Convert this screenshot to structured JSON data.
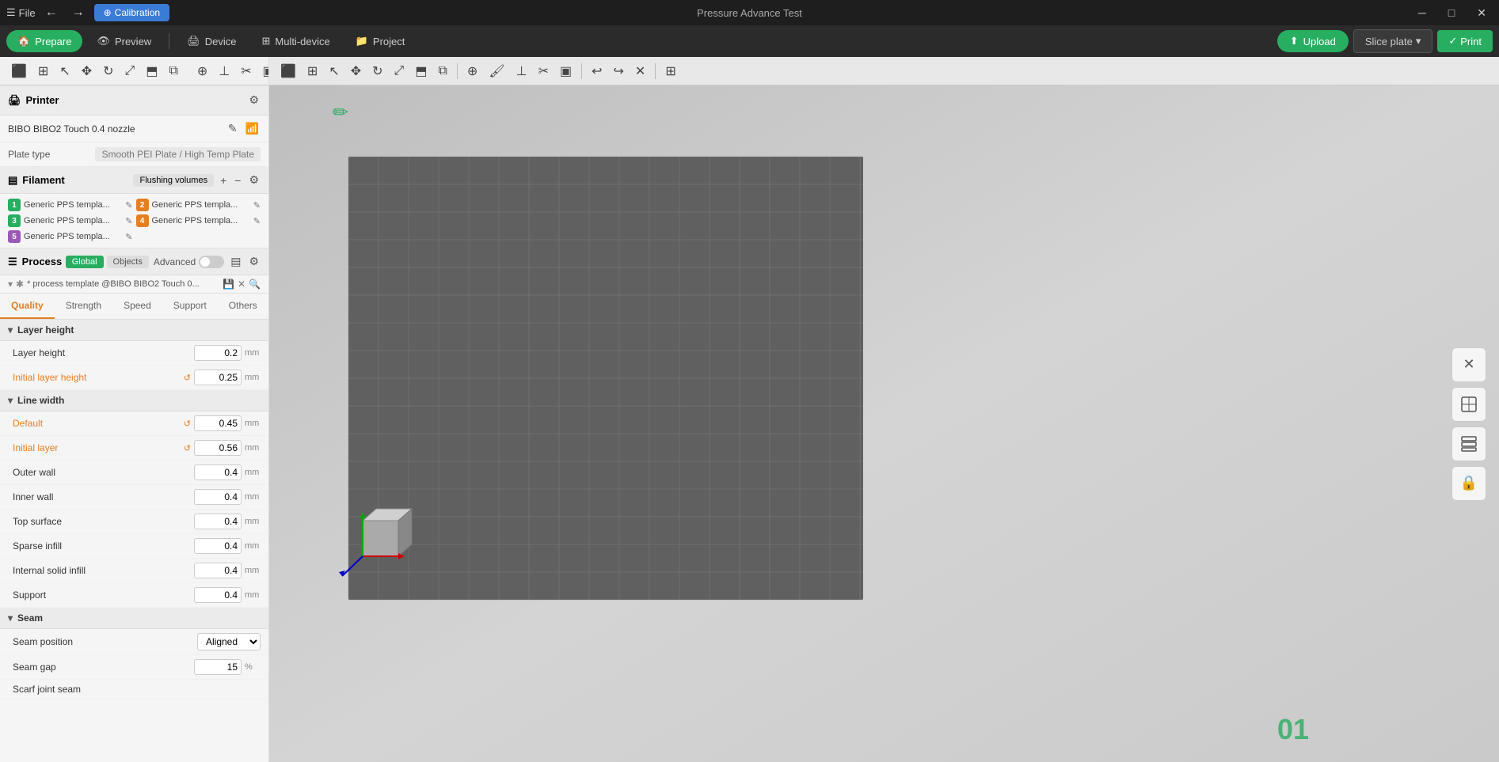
{
  "app": {
    "title": "Pressure Advance Test"
  },
  "titlebar": {
    "menu_label": "File",
    "calibration_label": "Calibration",
    "win_minimize": "─",
    "win_restore": "□",
    "win_close": "✕"
  },
  "main_toolbar": {
    "prepare_label": "Prepare",
    "preview_label": "Preview",
    "device_label": "Device",
    "multidevice_label": "Multi-device",
    "project_label": "Project",
    "upload_label": "Upload",
    "slice_label": "Slice plate",
    "print_label": "Print"
  },
  "printer": {
    "section_label": "Printer",
    "name": "BIBO BIBO2 Touch 0.4 nozzle",
    "plate_type_label": "Plate type",
    "plate_value": "Smooth PEI Plate / High Temp Plate"
  },
  "filament": {
    "section_label": "Filament",
    "flush_btn_label": "Flushing volumes",
    "items": [
      {
        "num": "1",
        "color": "#27ae60",
        "text": "Generic PPS templa..."
      },
      {
        "num": "2",
        "color": "#e67e22",
        "text": "Generic PPS templa..."
      },
      {
        "num": "3",
        "color": "#27ae60",
        "text": "Generic PPS templa..."
      },
      {
        "num": "4",
        "color": "#e67e22",
        "text": "Generic PPS templa..."
      },
      {
        "num": "5",
        "color": "#9b59b6",
        "text": "Generic PPS templa..."
      }
    ]
  },
  "process": {
    "section_label": "Process",
    "global_label": "Global",
    "objects_label": "Objects",
    "advanced_label": "Advanced",
    "template_name": "* process template @BIBO BIBO2 Touch 0..."
  },
  "quality_tabs": {
    "quality_label": "Quality",
    "strength_label": "Strength",
    "speed_label": "Speed",
    "support_label": "Support",
    "others_label": "Others"
  },
  "settings": {
    "layer_height_section": "Layer height",
    "layer_height_label": "Layer height",
    "layer_height_value": "0.2",
    "layer_height_unit": "mm",
    "initial_layer_height_label": "Initial layer height",
    "initial_layer_height_value": "0.25",
    "initial_layer_height_unit": "mm",
    "line_width_section": "Line width",
    "default_label": "Default",
    "default_value": "0.45",
    "default_unit": "mm",
    "initial_layer_lw_label": "Initial layer",
    "initial_layer_lw_value": "0.56",
    "initial_layer_lw_unit": "mm",
    "outer_wall_label": "Outer wall",
    "outer_wall_value": "0.4",
    "outer_wall_unit": "mm",
    "inner_wall_label": "Inner wall",
    "inner_wall_value": "0.4",
    "inner_wall_unit": "mm",
    "top_surface_label": "Top surface",
    "top_surface_value": "0.4",
    "top_surface_unit": "mm",
    "sparse_infill_label": "Sparse infill",
    "sparse_infill_value": "0.4",
    "sparse_infill_unit": "mm",
    "internal_solid_infill_label": "Internal solid infill",
    "internal_solid_infill_value": "0.4",
    "internal_solid_infill_unit": "mm",
    "support_label": "Support",
    "support_value": "0.4",
    "support_unit": "mm",
    "seam_section": "Seam",
    "seam_position_label": "Seam position",
    "seam_position_value": "Aligned",
    "seam_gap_label": "Seam gap",
    "seam_gap_value": "15",
    "seam_gap_unit": "%",
    "scarf_joint_seam_label": "Scarf joint seam"
  },
  "viewport": {
    "plate_number": "01"
  },
  "icons": {
    "grid": "⊞",
    "cursor": "↖",
    "move": "⊕",
    "rotate": "↻",
    "scale": "⤢",
    "flatten": "⬒",
    "split": "⧉",
    "paint": "🖌",
    "support": "⊥",
    "seam": "✂",
    "layercolor": "▣",
    "search": "🔍",
    "settings": "⚙",
    "expand": "⤡",
    "lock": "🔒",
    "close_x": "✕",
    "layers": "▤",
    "table": "▦",
    "reset": "↺",
    "wifi": "📶",
    "edit": "✎",
    "chevron_down": "▾",
    "save": "💾",
    "refresh": "⟳",
    "plus": "+",
    "minus": "−"
  }
}
